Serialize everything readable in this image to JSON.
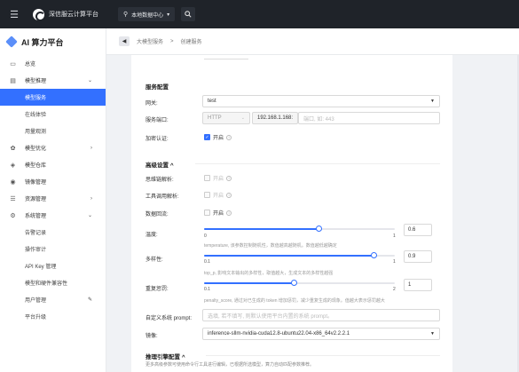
{
  "topbar": {
    "brand": "深信服云计算平台",
    "region": "本地数据中心",
    "region_caret": "▾"
  },
  "sidebar": {
    "title": "AI 算力平台",
    "items": [
      {
        "label": "总览",
        "icon": "monitor-icon",
        "level": 1
      },
      {
        "label": "模型推理",
        "icon": "server-icon",
        "level": 1,
        "chevron": "⌄"
      },
      {
        "label": "模型服务",
        "level": 2,
        "active": true
      },
      {
        "label": "在线体验",
        "level": 2
      },
      {
        "label": "用量观测",
        "level": 2
      },
      {
        "label": "模型优化",
        "icon": "gear-icon",
        "level": 1,
        "chevron": "›"
      },
      {
        "label": "模型仓库",
        "icon": "box-icon",
        "level": 1
      },
      {
        "label": "镜像管理",
        "icon": "disc-icon",
        "level": 1
      },
      {
        "label": "资源管理",
        "icon": "stack-icon",
        "level": 1,
        "chevron": "›"
      },
      {
        "label": "系统管理",
        "icon": "settings-icon",
        "level": 1,
        "chevron": "⌄"
      },
      {
        "label": "告警记录",
        "level": 2
      },
      {
        "label": "操作审计",
        "level": 2
      },
      {
        "label": "API Key 管理",
        "level": 2
      },
      {
        "label": "模型和硬件兼容性",
        "level": 2
      },
      {
        "label": "用户管理",
        "level": 2,
        "wrench": true
      },
      {
        "label": "平台升级",
        "level": 2
      }
    ]
  },
  "breadcrumb": {
    "parent": "大模型服务",
    "sep": ">",
    "current": "创建服务"
  },
  "form": {
    "service_config": {
      "heading": "服务配置",
      "gateway_label": "网关:",
      "gateway_value": "test",
      "port_label": "服务端口:",
      "protocol_value": "HTTP",
      "host_value": "192.168.1.168:",
      "port_placeholder": "端口, 如: 443",
      "auth_label": "加密认证:",
      "auth_text": "开启"
    },
    "advanced": {
      "heading": "高级设置",
      "toggle": "^",
      "thinking_label": "思维链解析:",
      "thinking_text": "开启",
      "tool_label": "工具调用解析:",
      "tool_text": "开启",
      "stream_label": "数据回流:",
      "stream_text": "开启",
      "temperature": {
        "label": "温度:",
        "min": "0",
        "max": "1",
        "value": "0.6",
        "fraction": 0.6,
        "hint": "temperature, 该参数控制随机性，数值越高越随机。数值越低越确定"
      },
      "top_p": {
        "label": "多样性:",
        "min": "0.1",
        "max": "1",
        "value": "0.9",
        "fraction": 0.889,
        "hint": "top_p, 影响文本输出的多样性，取值越大，生成文本的多样性越强"
      },
      "penalty": {
        "label": "重复惩罚:",
        "min": "0.1",
        "max": "2",
        "value": "1",
        "fraction": 0.474,
        "hint": "penalty_score, 通过对已生成的 token 增加惩罚，减少重复生成的现象。值越大表示惩罚越大"
      },
      "prompt_label": "自定义系统 prompt:",
      "prompt_placeholder": "选填, 若不填写, 则默认使用平台内置的系统 prompt。",
      "image_label": "镜像:",
      "image_value": "inference-sllm-nvidia-cuda12.8-ubuntu22.04-x86_64v2.2.2.1"
    },
    "engine": {
      "heading": "推理引擎配置",
      "toggle": "^",
      "desc": "更多高级参数可使用命令行工具进行编辑，已根据所选模型，算力自动匹配参数推荐。"
    }
  },
  "colors": {
    "accent": "#3370ff",
    "topbar": "#1f2329"
  }
}
